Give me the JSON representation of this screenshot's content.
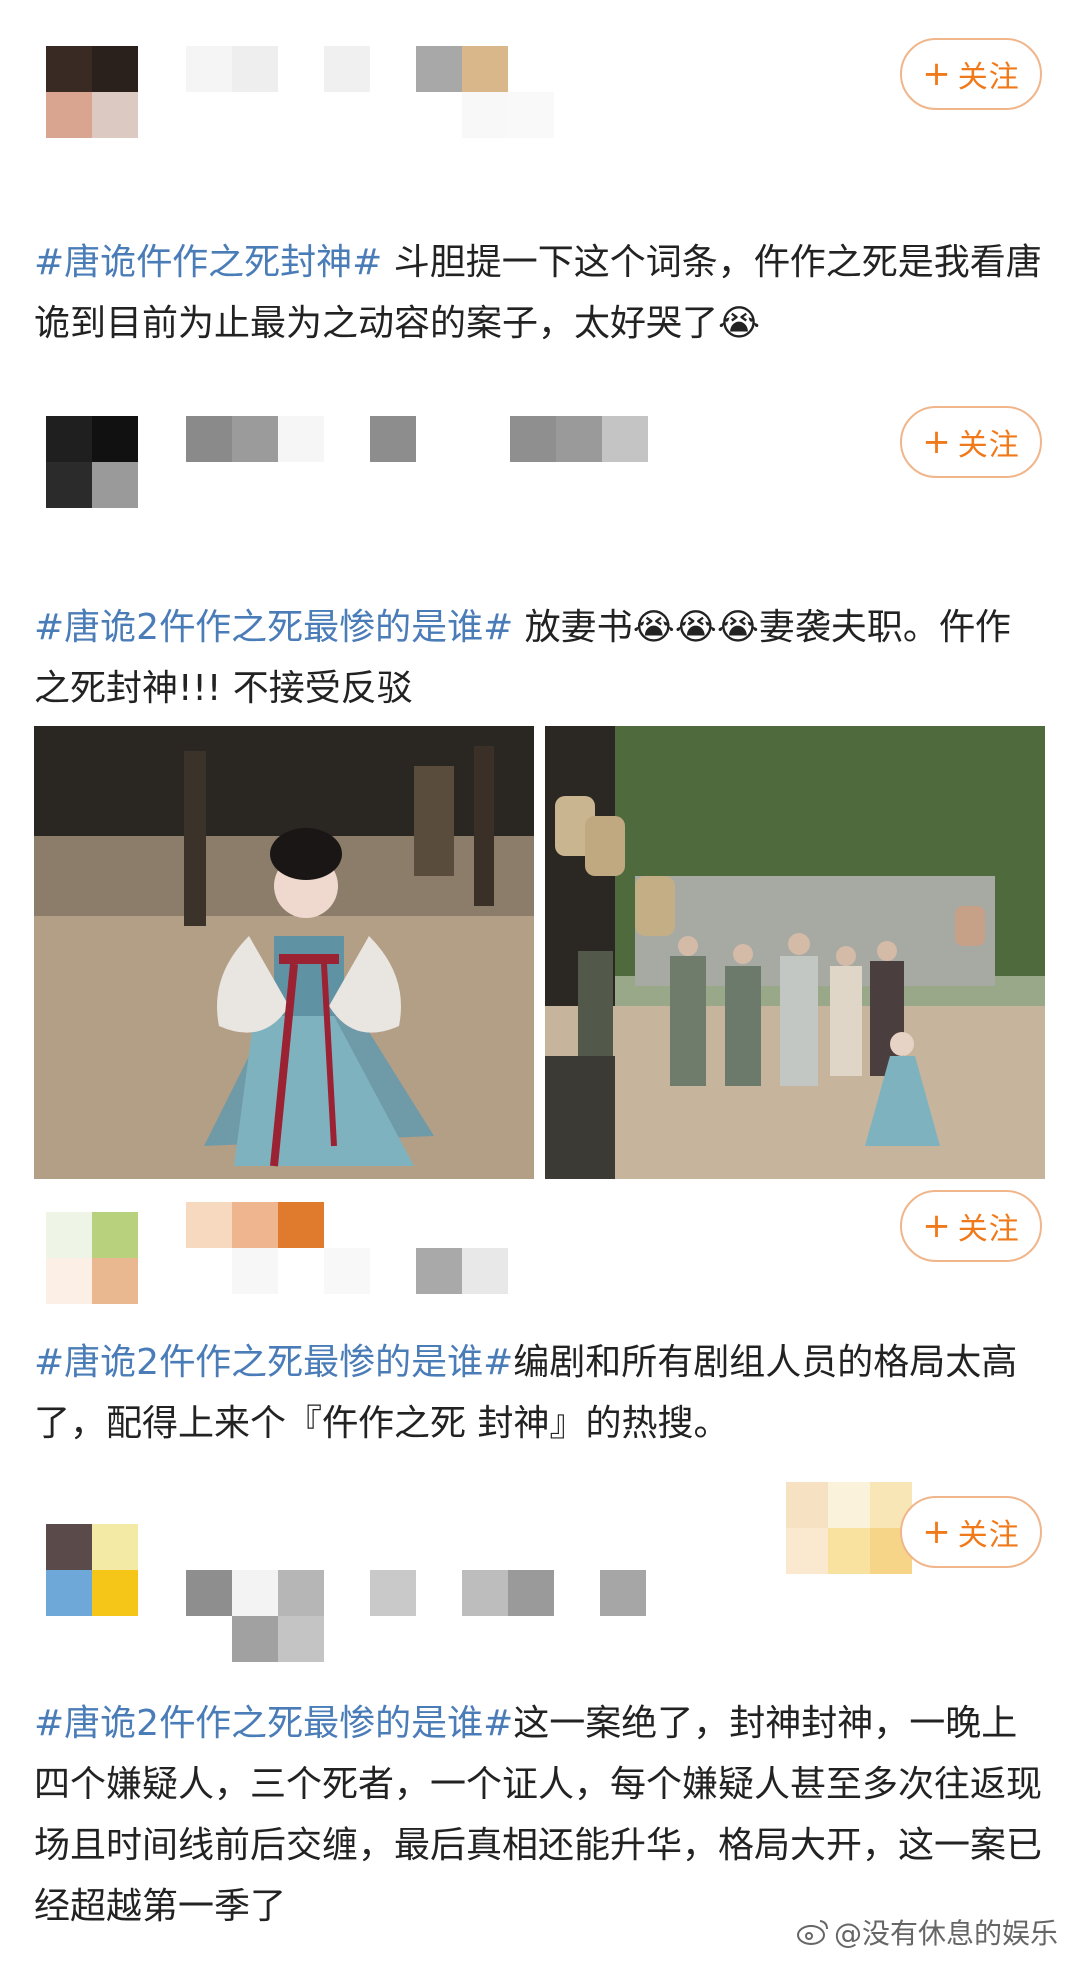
{
  "follow_label": "关注",
  "follow_plus": "+",
  "posts": [
    {
      "tag": "#唐诡仵作之死封神#",
      "text": " 斗胆提一下这个词条，仵作之死是我看唐诡到目前为止最为之动容的案子，太好哭了",
      "emoji": "😭"
    },
    {
      "tag": "#唐诡2仵作之死最惨的是谁#",
      "text1": "  放妻书",
      "emojis": "😭😭😭",
      "text2": "妻袭夫职。仵作之死封神!!! 不接受反驳"
    },
    {
      "tag": "#唐诡2仵作之死最惨的是谁#",
      "text": "编剧和所有剧组人员的格局太高了，配得上来个『仵作之死 封神』的热搜。"
    },
    {
      "tag": "#唐诡2仵作之死最惨的是谁#",
      "text": "这一案绝了，封神封神，一晚上四个嫌疑人，三个死者，一个证人，每个嫌疑人甚至多次往返现场且时间线前后交缠，最后真相还能升华，格局大开，这一案已经超越第一季了"
    }
  ],
  "watermark": "@没有休息的娱乐",
  "watermark_icon": "weibo-logo-icon"
}
